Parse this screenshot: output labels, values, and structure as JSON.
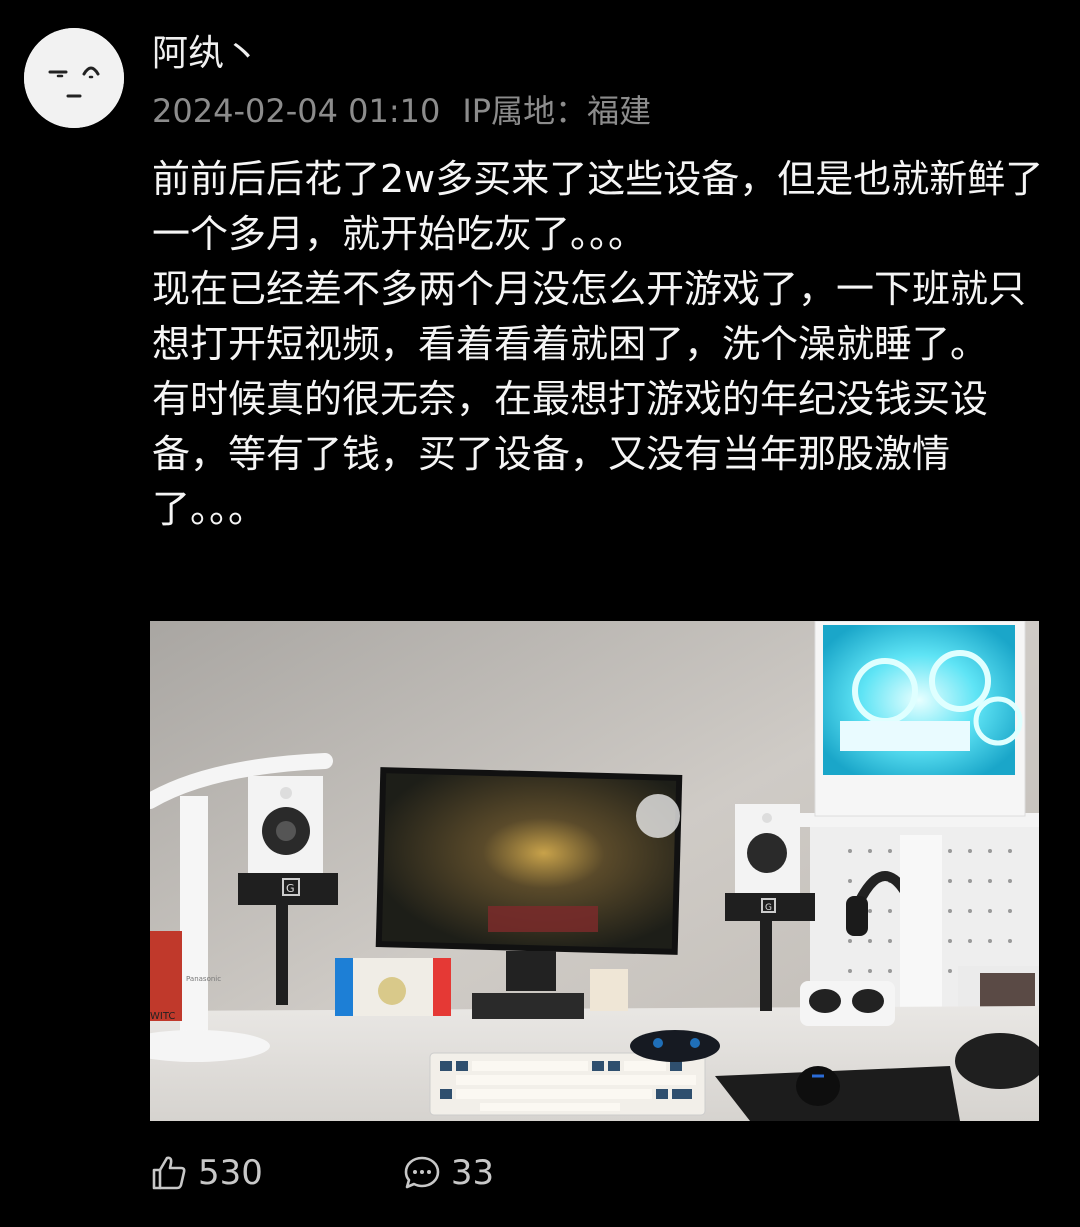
{
  "post": {
    "author": "阿纨丶",
    "timestamp": "2024-02-04 01:10",
    "ip_location": "IP属地：福建",
    "paragraphs": [
      "前前后后花了2w多买来了这些设备，但是也就新鲜了一个多月，就开始吃灰了。。。",
      "现在已经差不多两个月没怎么开游戏了，一下班就只想打开短视频，看着看着就困了，洗个澡就睡了。",
      "有时候真的很无奈，在最想打游戏的年纪没钱买设备，等有了钱，买了设备，又没有当年那股激情了。。。"
    ],
    "image": {
      "speaker_logo": "G",
      "lamp_brand": "Panasonic",
      "book_text": "WITC"
    }
  },
  "actions": {
    "likes": {
      "icon": "thumbs-up-icon",
      "count": "530"
    },
    "comments": {
      "icon": "comment-bubble-icon",
      "count": "33"
    }
  },
  "colors": {
    "background": "#000000",
    "meta_gray": "#8c8c8c",
    "text": "#f5f5f5"
  }
}
